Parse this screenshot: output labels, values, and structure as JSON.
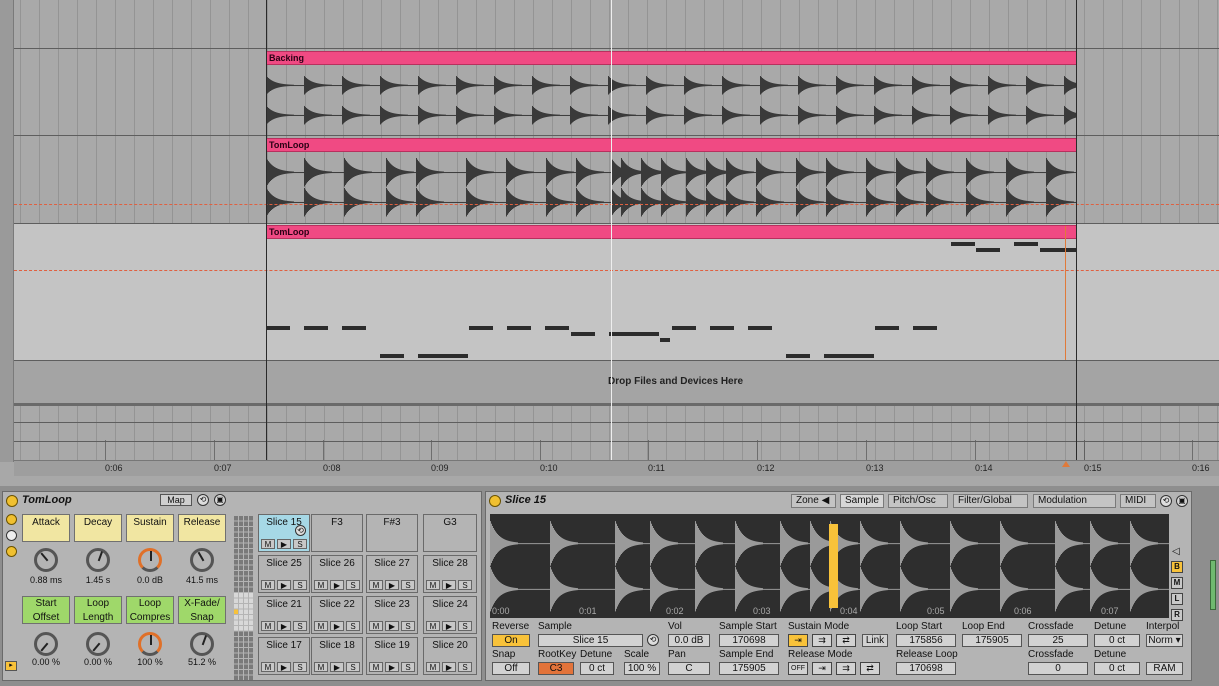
{
  "arrangement": {
    "clips": [
      {
        "name": "Backing"
      },
      {
        "name": "TomLoop"
      },
      {
        "name": "TomLoop"
      }
    ],
    "drop_text": "Drop Files and Devices Here",
    "ruler_ticks": [
      "0:06",
      "0:07",
      "0:08",
      "0:09",
      "0:10",
      "0:11",
      "0:12",
      "0:13",
      "0:14",
      "0:15",
      "0:16"
    ]
  },
  "simpler": {
    "title": "TomLoop",
    "map_label": "Map",
    "envelope": [
      {
        "label": "Attack",
        "value": "0.88 ms"
      },
      {
        "label": "Decay",
        "value": "1.45 s"
      },
      {
        "label": "Sustain",
        "value": "0.0 dB"
      },
      {
        "label": "Release",
        "value": "41.5 ms"
      }
    ],
    "controls": [
      {
        "label": "Start Offset",
        "value": "0.00 %"
      },
      {
        "label": "Loop Length",
        "value": "0.00 %"
      },
      {
        "label": "Loop Compres",
        "value": "100 %"
      },
      {
        "label": "X-Fade/ Snap",
        "value": "51.2 %"
      }
    ],
    "pads": [
      [
        "Slice 15",
        "F3",
        "F#3",
        "G3"
      ],
      [
        "Slice 25",
        "Slice 26",
        "Slice 27",
        "Slice 28"
      ],
      [
        "Slice 21",
        "Slice 22",
        "Slice 23",
        "Slice 24"
      ],
      [
        "Slice 17",
        "Slice 18",
        "Slice 19",
        "Slice 20"
      ]
    ],
    "pad_buttons": [
      "M",
      "▶",
      "S"
    ]
  },
  "sampler": {
    "title": "Slice 15",
    "tabs": [
      "Zone ◀",
      "Sample",
      "Pitch/Osc",
      "Filter/Global",
      "Modulation",
      "MIDI"
    ],
    "time_labels": [
      "0:00",
      "0:01",
      "0:02",
      "0:03",
      "0:04",
      "0:05",
      "0:06",
      "0:07"
    ],
    "side_buttons": [
      "B",
      "M",
      "L",
      "R"
    ],
    "params": {
      "reverse_label": "Reverse",
      "reverse_value": "On",
      "snap_label": "Snap",
      "snap_value": "Off",
      "sample_label": "Sample",
      "sample_value": "Slice 15",
      "rootkey_label": "RootKey",
      "rootkey_value": "C3",
      "detune_label": "Detune",
      "detune_value": "0 ct",
      "scale_label": "Scale",
      "scale_value": "100 %",
      "vol_label": "Vol",
      "vol_value": "0.0 dB",
      "pan_label": "Pan",
      "pan_value": "C",
      "sample_start_label": "Sample Start",
      "sample_start_value": "170698",
      "sample_end_label": "Sample End",
      "sample_end_value": "175905",
      "sustain_mode_label": "Sustain Mode",
      "release_mode_label": "Release Mode",
      "release_off": "OFF",
      "link_label": "Link",
      "loop_start_label": "Loop Start",
      "loop_start_value": "175856",
      "loop_end_label": "Loop End",
      "loop_end_value": "175905",
      "release_loop_label": "Release Loop",
      "release_loop_value": "170698",
      "crossfade_label": "Crossfade",
      "crossfade_value": "25",
      "crossfade2_label": "Crossfade",
      "crossfade2_value": "0",
      "detune2_label": "Detune",
      "detune2_value": "0 ct",
      "detune3_label": "Detune",
      "detune3_value": "0 ct",
      "interpol_label": "Interpol",
      "interpol_value": "Norm ▾",
      "ram_label": "RAM"
    }
  }
}
